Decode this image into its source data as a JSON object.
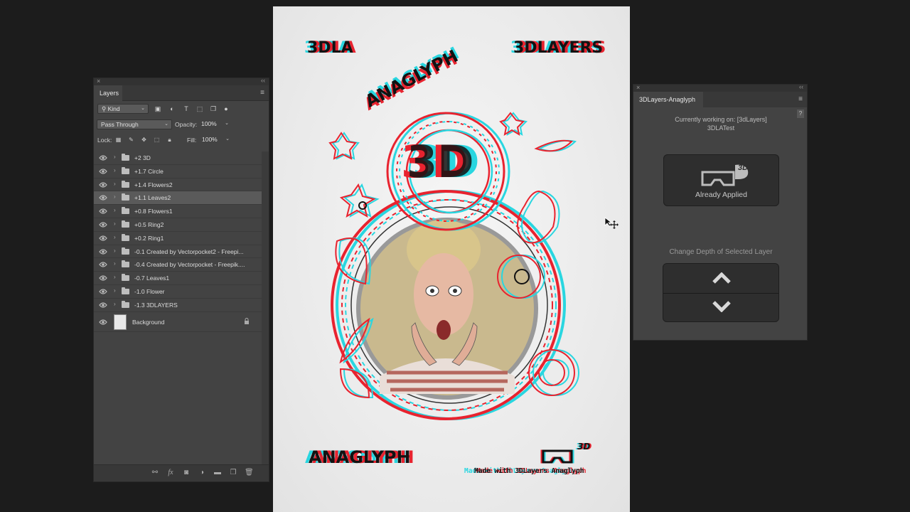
{
  "layers_panel": {
    "title": "Layers",
    "filter_kind": "Kind",
    "blend_mode": "Pass Through",
    "opacity_label": "Opacity:",
    "opacity_value": "100%",
    "lock_label": "Lock:",
    "fill_label": "Fill:",
    "fill_value": "100%",
    "layers": [
      {
        "name": "+2 3D",
        "active": false
      },
      {
        "name": "+1.7 Circle",
        "active": false
      },
      {
        "name": "+1.4 Flowers2",
        "active": false
      },
      {
        "name": "+1.1 Leaves2",
        "active": true
      },
      {
        "name": "+0.8 Flowers1",
        "active": false
      },
      {
        "name": "+0.5 Ring2",
        "active": false
      },
      {
        "name": "+0.2 Ring1",
        "active": false
      },
      {
        "name": "-0.1 Created by Vectorpocket2 - Freepi...",
        "active": false
      },
      {
        "name": "-0.4 Created by Vectorpocket - Freepik....",
        "active": false
      },
      {
        "name": "-0.7 Leaves1",
        "active": false
      },
      {
        "name": "-1.0 Flower",
        "active": false
      },
      {
        "name": "-1.3 3DLAYERS",
        "active": false
      }
    ],
    "background_layer": "Background"
  },
  "document": {
    "top_left_text": "3DLA",
    "top_right_text": "3DLAYERS",
    "arc_text": "ANAGLYPH",
    "center_text": "3D",
    "bottom_left_text": "ANAGLYPH",
    "bottom_right_text": "Made with 3DLayers Anaglyph",
    "logo_badge": "3D"
  },
  "anaglyph_panel": {
    "title": "3DLayers-Anaglyph",
    "help": "?",
    "status_line1": "Currently working on: [3dLayers]",
    "status_line2": "3DLATest",
    "apply_label": "Already Applied",
    "apply_badge": "3D",
    "depth_label": "Change Depth of Selected Layer"
  },
  "colors": {
    "cyan": "#29d6e0",
    "red": "#e8232f",
    "panel_bg": "#434343",
    "app_bg": "#1c1c1c"
  }
}
